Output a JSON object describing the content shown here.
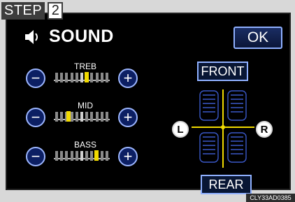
{
  "step": {
    "label": "STEP",
    "number": "2"
  },
  "header": {
    "title": "SOUND",
    "ok_label": "OK"
  },
  "tone": [
    {
      "label": "TREB",
      "level": 8
    },
    {
      "label": "MID",
      "level": -5
    },
    {
      "label": "BASS",
      "level": 9
    }
  ],
  "balance": {
    "front_label": "FRONT",
    "rear_label": "REAR",
    "left_label": "L",
    "right_label": "R"
  },
  "footer": {
    "image_code": "CLY33AD0385"
  },
  "colors": {
    "marker": "#f1da00",
    "accent": "#8fb0ff",
    "screen": "#000000"
  },
  "icons": {
    "sound": "speaker-icon",
    "minus": "minus-icon",
    "plus": "plus-icon"
  }
}
